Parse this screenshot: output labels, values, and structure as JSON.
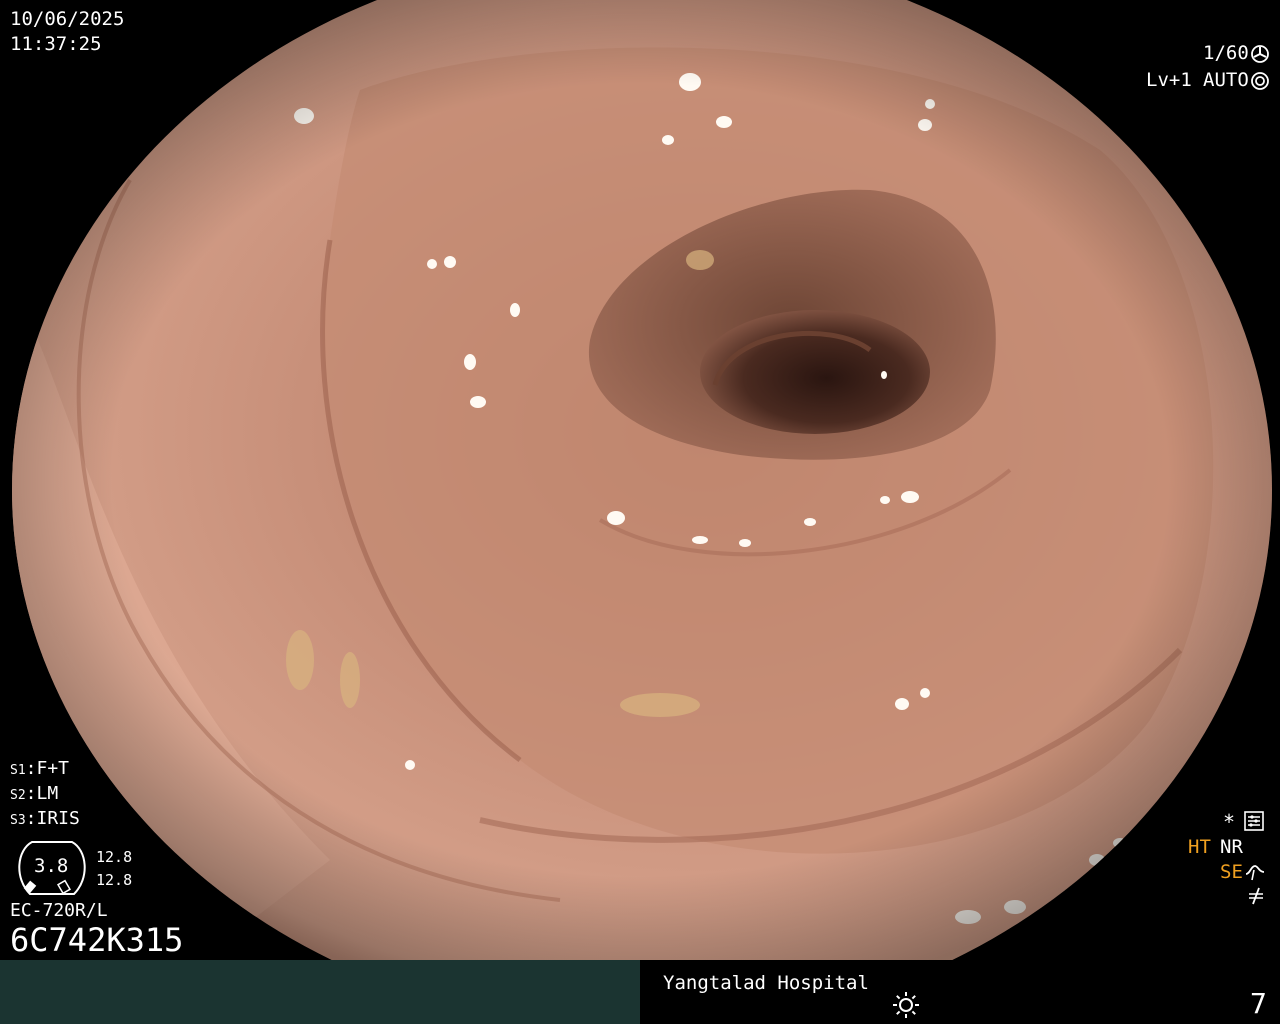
{
  "top_left": {
    "date": "10/06/2025",
    "time": "11:37:25"
  },
  "top_right": {
    "shutter": "1/60",
    "level": "Lv+1",
    "iris_mode": "AUTO"
  },
  "bottom_left": {
    "s1_key": "S1",
    "s1_val": "F+T",
    "s2_key": "S2",
    "s2_val": "LM",
    "s3_key": "S3",
    "s3_val": "IRIS",
    "gauge_value": "3.8",
    "gauge_top": "12.8",
    "gauge_bottom": "12.8",
    "scope_model": "EC-720R/L",
    "serial": "6C742K315"
  },
  "bottom_right": {
    "star": "*",
    "ht": "HT",
    "nr": "NR",
    "se": "SE"
  },
  "footer": {
    "hospital": "Yangtalad Hospital",
    "image_number": "7"
  },
  "colors": {
    "accent_orange": "#f0a020",
    "footer_teal": "#1b3431",
    "mucosa": "#c98f78"
  },
  "icons": [
    "fan-icon",
    "camera-iris-icon",
    "settings-panel-icon",
    "enhance-curve-icon",
    "no-filter-icon",
    "brightness-sun-icon"
  ]
}
